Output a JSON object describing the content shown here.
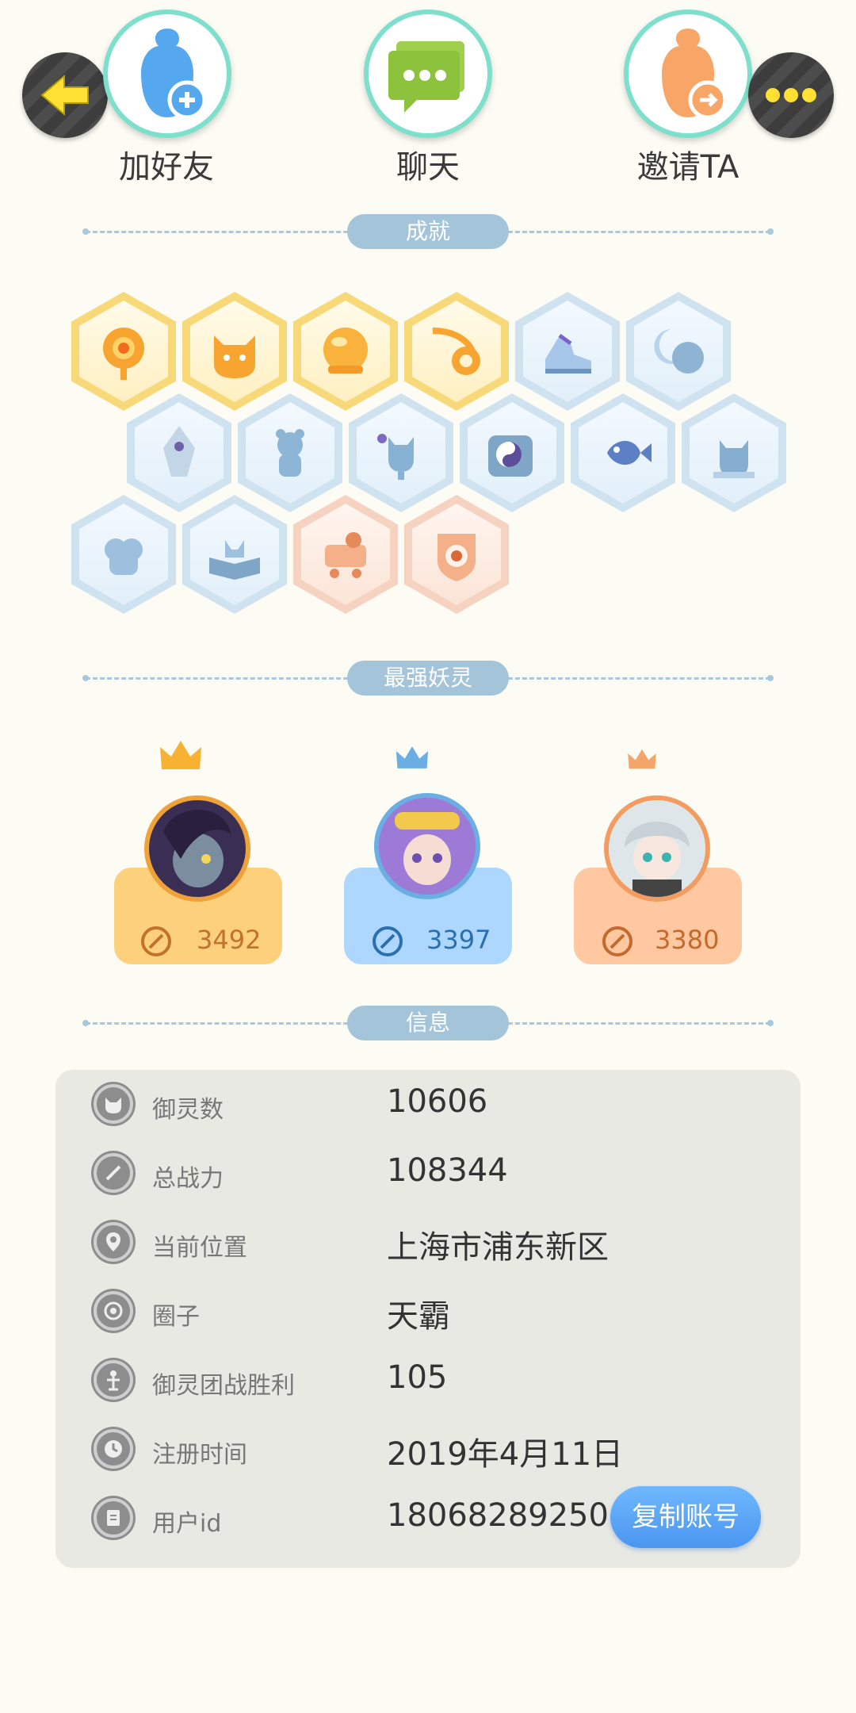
{
  "actions": {
    "add_friend": "加好友",
    "chat": "聊天",
    "invite": "邀请TA"
  },
  "sections": {
    "achievements": "成就",
    "strongest": "最强妖灵",
    "info": "信息"
  },
  "badges": [
    {
      "name": "sun-badge",
      "tier": "gold"
    },
    {
      "name": "cat-moon-badge",
      "tier": "gold"
    },
    {
      "name": "ball-badge",
      "tier": "gold"
    },
    {
      "name": "yinyang-comet-badge",
      "tier": "gold"
    },
    {
      "name": "shoe-badge",
      "tier": "blue"
    },
    {
      "name": "moon-badge",
      "tier": "blue"
    },
    {
      "name": "crystal-badge",
      "tier": "blue"
    },
    {
      "name": "bear-badge",
      "tier": "blue"
    },
    {
      "name": "cat-flower-badge",
      "tier": "blue"
    },
    {
      "name": "yinyang-stone-badge",
      "tier": "blue"
    },
    {
      "name": "fish-badge",
      "tier": "blue"
    },
    {
      "name": "dragon-badge",
      "tier": "blue"
    },
    {
      "name": "blob-badge",
      "tier": "blue"
    },
    {
      "name": "book-badge",
      "tier": "blue"
    },
    {
      "name": "cart-badge",
      "tier": "peach"
    },
    {
      "name": "shield-badge",
      "tier": "peach"
    }
  ],
  "spirits": [
    {
      "score": "3492",
      "color": "#fdd17b",
      "text_color": "#c2722c",
      "crown": "gold"
    },
    {
      "score": "3397",
      "color": "#aed7ff",
      "text_color": "#2b6fb0",
      "crown": "blue"
    },
    {
      "score": "3380",
      "color": "#ffc8a0",
      "text_color": "#c46a2c",
      "crown": "orange"
    }
  ],
  "info": {
    "rows": [
      {
        "label": "御灵数",
        "value": "10606"
      },
      {
        "label": "总战力",
        "value": "108344"
      },
      {
        "label": "当前位置",
        "value": "上海市浦东新区"
      },
      {
        "label": "圈子",
        "value": "天霸"
      },
      {
        "label": "御灵团战胜利",
        "value": "105"
      },
      {
        "label": "注册时间",
        "value": "2019年4月11日"
      },
      {
        "label": "用户id",
        "value": "18068289250"
      }
    ],
    "copy_button": "复制账号"
  }
}
